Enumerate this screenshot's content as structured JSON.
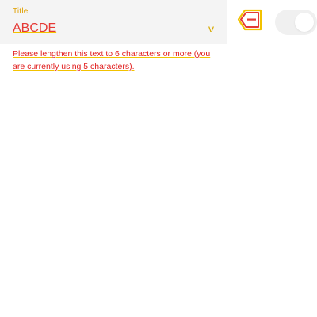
{
  "field": {
    "label": "Title",
    "value": "ABCDE",
    "chevron": "v"
  },
  "helper": {
    "text": "Please lengthen this text to 6 characters or more (you are currently using 5 characters)."
  },
  "icons": {
    "clear": "backspace-icon"
  },
  "toggle": {
    "state": "off"
  },
  "colors": {
    "error": "#e11d1d",
    "underline": "#f2c200",
    "field_bg": "#f4f4f4",
    "toggle_bg": "#f0f0f0"
  }
}
